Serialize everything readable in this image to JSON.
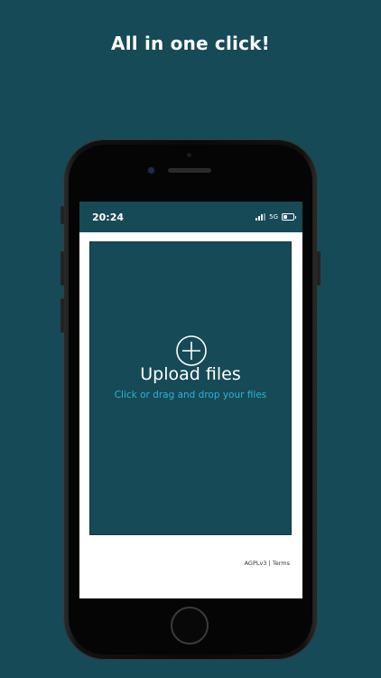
{
  "promo": {
    "headline": "All in one click!"
  },
  "status_bar": {
    "time": "20:24",
    "network": "5G",
    "signal_icon": "signal-bars-icon",
    "battery_icon": "battery-icon"
  },
  "upload": {
    "icon": "plus-circle-icon",
    "title": "Upload files",
    "hint": "Click or drag and drop your files"
  },
  "footer": {
    "license": "AGPLv3",
    "separator": "|",
    "terms": "Terms"
  },
  "colors": {
    "background": "#164a56",
    "accent": "#2bb4d6",
    "screen": "#ffffff"
  }
}
